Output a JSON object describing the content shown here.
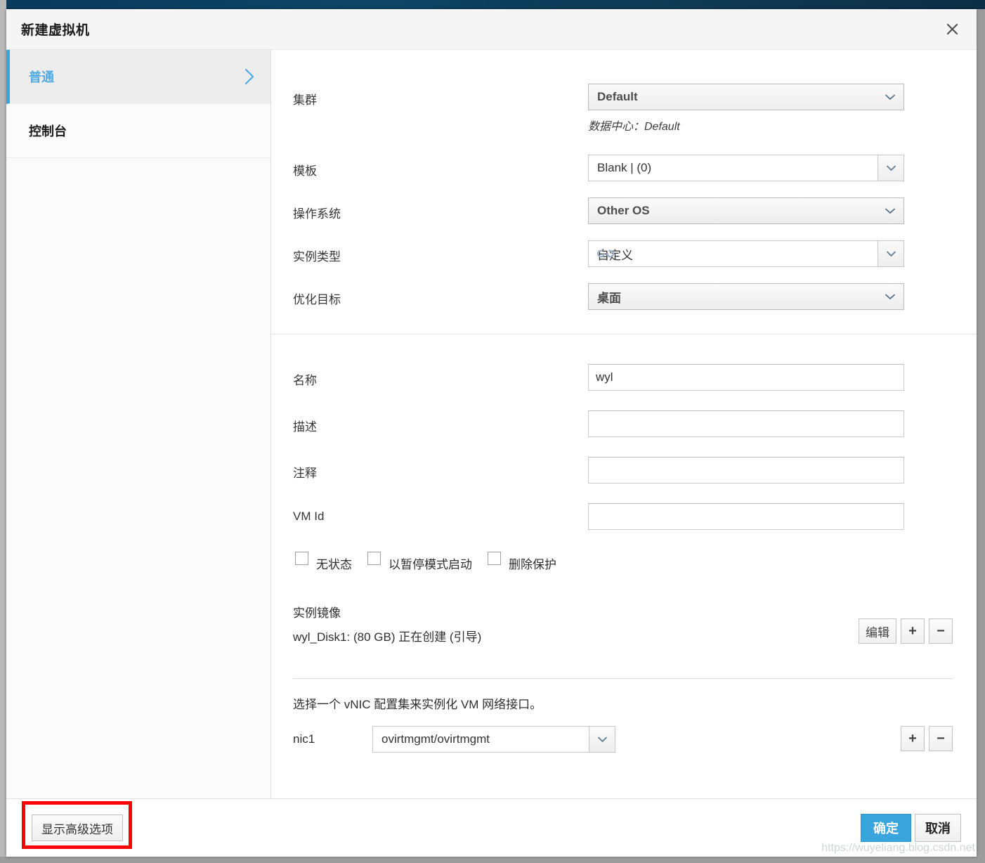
{
  "window": {
    "title": "新建虚拟机",
    "close_icon": "close-icon"
  },
  "sidebar": {
    "items": [
      {
        "label": "普通",
        "active": true,
        "chevron": "chevron-right-icon"
      },
      {
        "label": "控制台",
        "active": false
      }
    ]
  },
  "form": {
    "cluster": {
      "label": "集群",
      "value": "Default",
      "hint": "数据中心：Default"
    },
    "template": {
      "label": "模板",
      "value": "Blank |  (0)"
    },
    "operating_system": {
      "label": "操作系统",
      "value": "Other OS"
    },
    "instance_type": {
      "label": "实例类型",
      "value": "自定义",
      "icon": "broken-chain-icon"
    },
    "optimized_for": {
      "label": "优化目标",
      "value": "桌面"
    },
    "name": {
      "label": "名称",
      "value": "wyl",
      "placeholder": ""
    },
    "description": {
      "label": "描述",
      "value": "",
      "placeholder": ""
    },
    "comment": {
      "label": "注释",
      "value": "",
      "placeholder": ""
    },
    "vm_id": {
      "label": "VM Id",
      "value": "",
      "placeholder": ""
    },
    "checkboxes": [
      {
        "label": "无状态",
        "checked": false
      },
      {
        "label": "以暂停模式启动",
        "checked": false
      },
      {
        "label": "删除保护",
        "checked": false
      }
    ],
    "instance_images": {
      "heading": "实例镜像",
      "disk": "wyl_Disk1: (80 GB) 正在创建 (引导)",
      "edit_label": "编辑",
      "add_label": "+",
      "remove_label": "−"
    },
    "nic": {
      "note": "选择一个 vNIC 配置集来实例化 VM 网络接口。",
      "name": "nic1",
      "value": "ovirtmgmt/ovirtmgmt",
      "add_label": "+",
      "remove_label": "−"
    }
  },
  "footer": {
    "advanced_label": "显示高级选项",
    "ok_label": "确定",
    "cancel_label": "取消"
  },
  "watermark": "https://wuyeliang.blog.csdn.net",
  "colors": {
    "accent": "#39a5dc",
    "header_bg": "#f5f5f5",
    "annotation": "#fa0505",
    "backdrop": "#0d3551"
  }
}
